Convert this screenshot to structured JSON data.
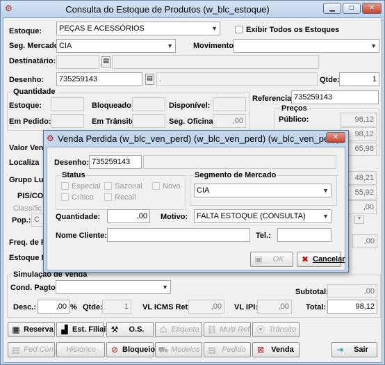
{
  "main": {
    "title": "Consulta do Estoque de Produtos (w_blc_estoque)",
    "estoque_label": "Estoque:",
    "estoque_value": "PEÇAS E ACESSÓRIOS",
    "exibir_label": "Exibir Todos os Estoques",
    "seg_label": "Seg. Mercado:",
    "seg_value": "CIA",
    "mov_label": "Movimento:",
    "mov_value": "",
    "dest_label": "Destinatário:",
    "desenho_label": "Desenho:",
    "desenho_value": "735259143",
    "desenho_desc": ".",
    "qtde_label": "Qtde:",
    "qtde_value": "1",
    "quant_group": "Quantidade",
    "estoque2_label": "Estoque:",
    "bloq_label": "Bloqueado:",
    "disp_label": "Disponível:",
    "pedido_label": "Em Pedido:",
    "transito_label": "Em Trânsito:",
    "segof_label": "Seg. Oficina:",
    "segof_value": ",00",
    "ref_label": "Referencia:",
    "ref_value": "735259143",
    "precos_group": "Preços",
    "publico_label": "Público:",
    "publico_value": "98,12",
    "p2_value": "98,12",
    "p3_value": "65,98",
    "valor_label": "Valor Vend",
    "local_label": "Localiza",
    "grupo_label": "Grupo Lucr",
    "g1_value": "48,21",
    "g2_value": "55,92",
    "pis_label": "PIS/COF",
    "pis_value": ",00",
    "classif_label": "Classific",
    "pop_label": "Pop.:",
    "pop_value": "C",
    "freq_label": "Freq. de Pe",
    "freq_value": ",00",
    "estideal_label": "Estoque Ide",
    "sim_group": "Simulação de Venda",
    "cond_label": "Cond. Pagto:",
    "subtotal_label": "Subtotal:",
    "subtotal_value": ",00",
    "desc_label": "Desc.:",
    "desc_value": ",00",
    "pct": "%",
    "qtde2_label": "Qtde:",
    "qtde2_value": "1",
    "icms_label": "VL ICMS Ret:",
    "icms_value": ",00",
    "ipi_label": "VL IPI:",
    "ipi_value": ",00",
    "total_label": "Total:",
    "total_value": "98,12"
  },
  "buttons": {
    "reserva": "Reserva",
    "filiais": "Est. Filiais",
    "os": "O.S.",
    "etiqueta": "Etiqueta",
    "multiref": "Multi Ref.",
    "transito": "Trânsito",
    "pedcomp": "Ped.Comp",
    "historico": "Histórico",
    "bloqueio": "Bloqueio",
    "modelos": "Modelos",
    "pedido": "Pedido",
    "venda": "Venda",
    "sair": "Sair"
  },
  "dialog": {
    "title": "Venda Perdida (w_blc_ven_perd) (w_blc_ven_perd) (w_blc_ven_perd) ...",
    "desenho_label": "Desenho:",
    "desenho_value": "735259143",
    "status_group": "Status",
    "especial": "Especial",
    "sazonal": "Sazonal",
    "novo": "Novo",
    "critico": "Crítico",
    "recall": "Recall",
    "seg_group": "Segmento de Mercado",
    "seg_value": "CIA",
    "quant_label": "Quantidade:",
    "quant_value": ",00",
    "motivo_label": "Motivo:",
    "motivo_value": "FALTA ESTOQUE (CONSULTA)",
    "cliente_label": "Nome Cliente:",
    "tel_label": "Tel.:",
    "ok": "OK",
    "cancelar": "Cancelar"
  }
}
